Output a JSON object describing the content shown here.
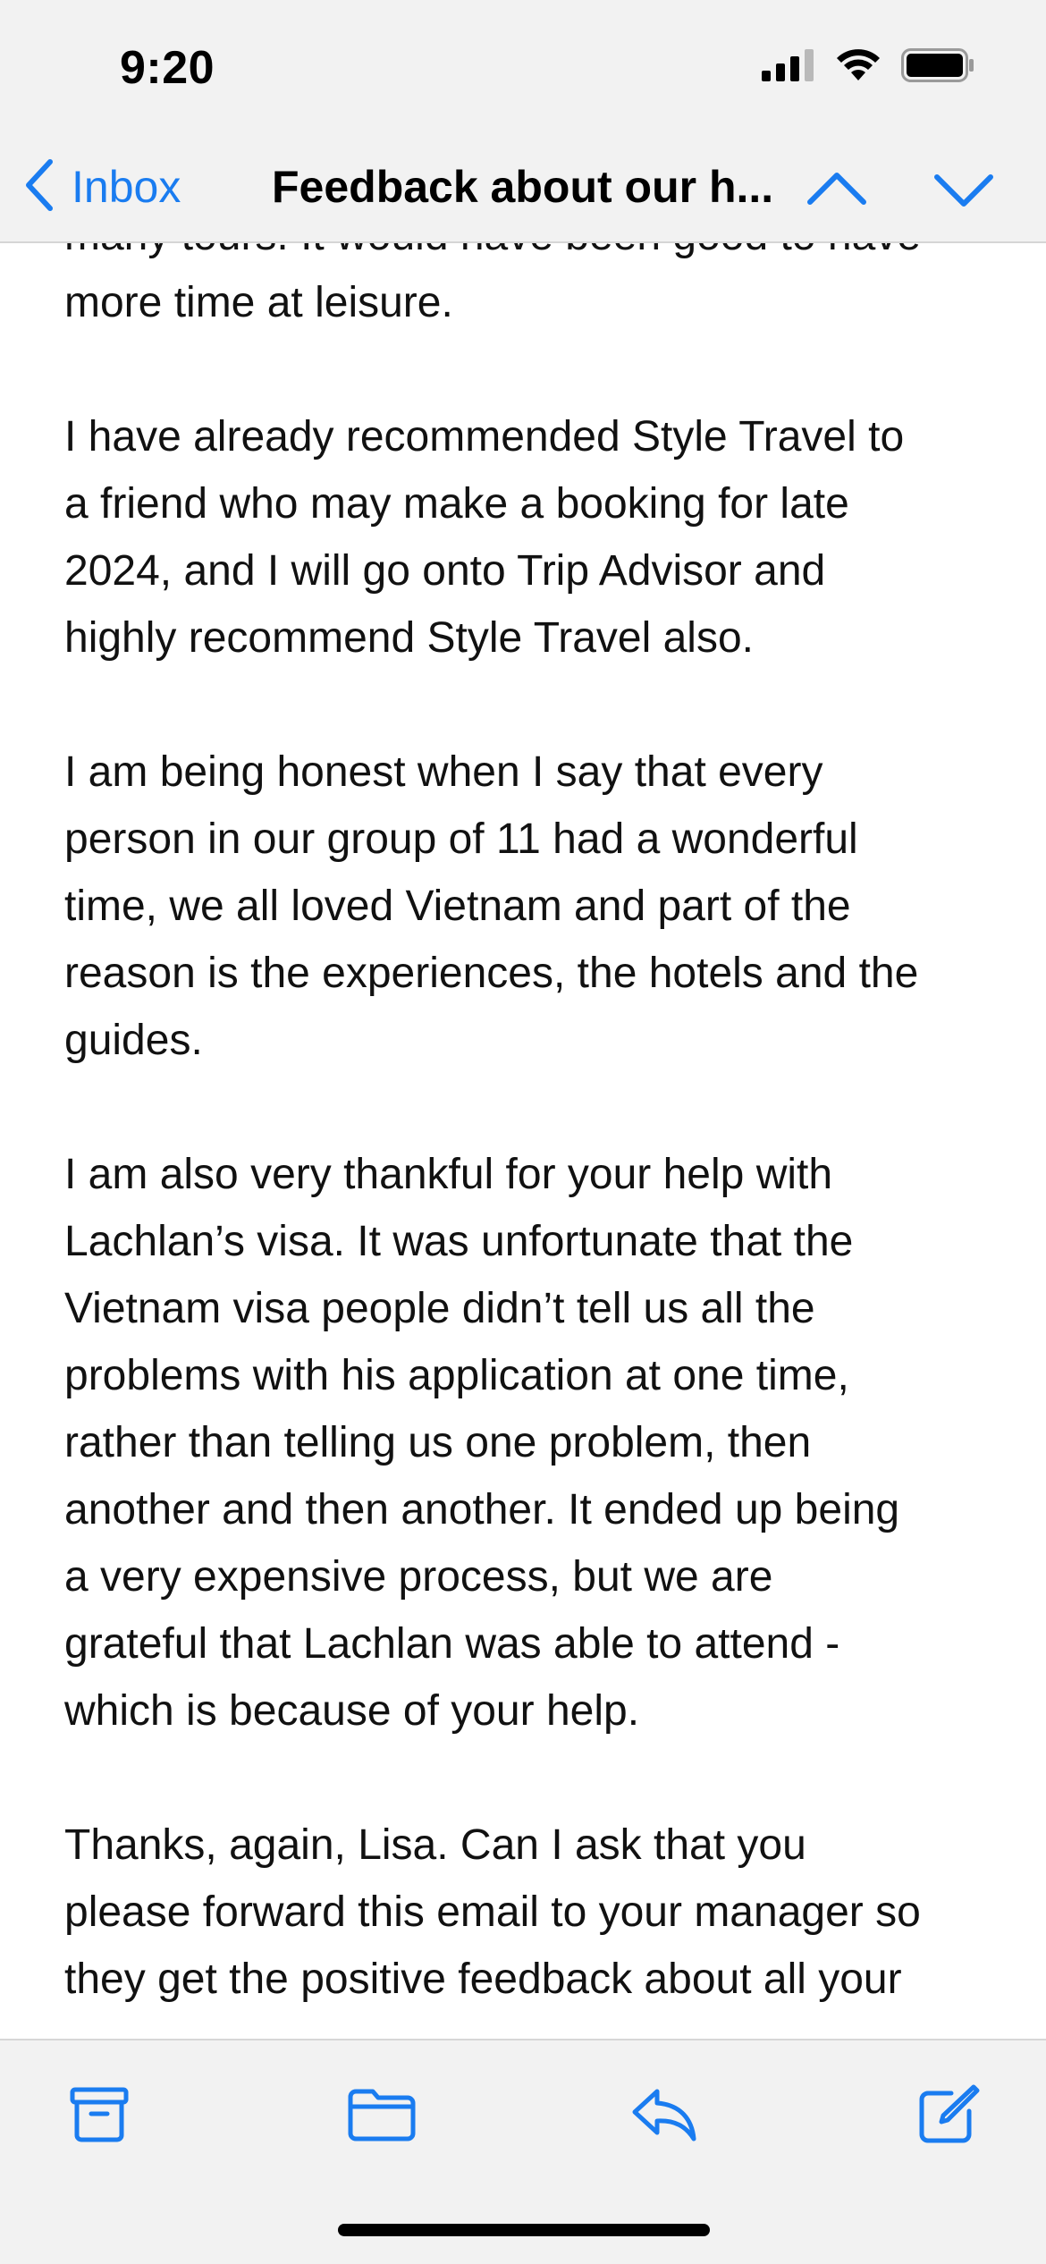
{
  "status_bar": {
    "time": "9:20"
  },
  "nav": {
    "back_label": "Inbox",
    "title": "Feedback about our h..."
  },
  "email": {
    "paragraphs": [
      {
        "lines": [
          "many tours. It would have been good to have",
          "more time at leisure."
        ]
      },
      {
        "lines": [
          "I have already recommended Style Travel to",
          "a friend who may make a booking for late",
          "2024, and I will go onto Trip Advisor and",
          "highly recommend Style Travel also."
        ]
      },
      {
        "lines": [
          "I am being honest when I say that every",
          "person in our group of 11 had a wonderful",
          "time, we all loved Vietnam and part of the",
          "reason is the experiences, the hotels and the",
          "guides."
        ]
      },
      {
        "lines": [
          "I am also very thankful for your help with",
          "Lachlan’s visa. It was unfortunate that the",
          "Vietnam visa people didn’t tell us all the",
          "problems with his application at one time,",
          "rather than telling us one problem, then",
          "another and then another. It ended up being",
          "a very expensive process, but we are",
          "grateful that Lachlan was able to attend -",
          "which is because of your help."
        ]
      },
      {
        "lines": [
          "Thanks, again, Lisa. Can I ask that you",
          "please forward this email to your manager so",
          "they get the positive feedback about all your"
        ]
      }
    ]
  },
  "toolbar": {
    "icons": [
      "archive-icon",
      "folder-icon",
      "reply-icon",
      "compose-icon"
    ]
  },
  "colors": {
    "accent": "#1a7cf0",
    "bar_background": "#f2f2f2",
    "text": "#111111"
  }
}
